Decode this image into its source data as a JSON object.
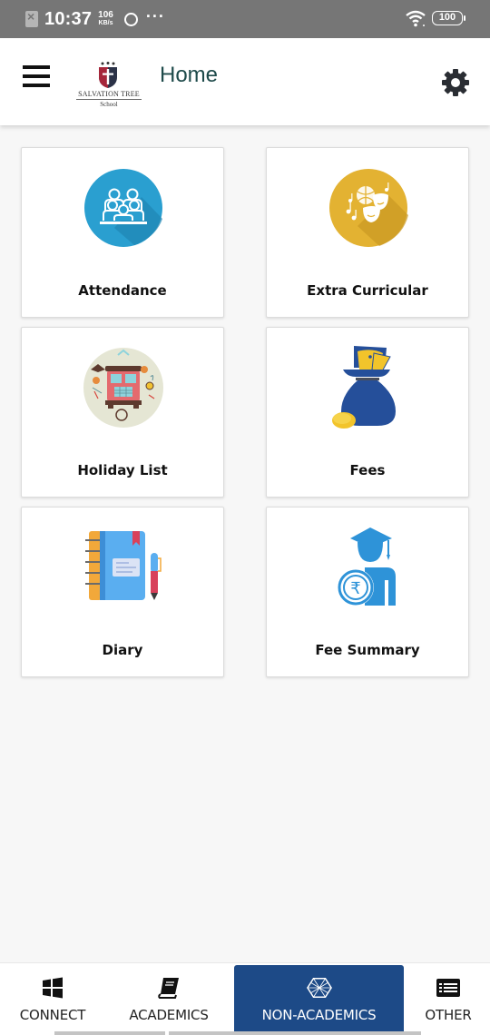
{
  "status_bar": {
    "time": "10:37",
    "net_speed_value": "106",
    "net_speed_unit": "KB/s",
    "more": "···",
    "battery": "100"
  },
  "app_bar": {
    "school_name_line1": "SALVATION TREE",
    "school_name_line2": "School",
    "title": "Home"
  },
  "tiles": [
    {
      "label": "Attendance",
      "icon": "attendance-icon",
      "color": "#2a9fd0"
    },
    {
      "label": "Extra Curricular",
      "icon": "extra-curricular-icon",
      "color": "#e3b232"
    },
    {
      "label": "Holiday List",
      "icon": "holiday-bus-icon",
      "color": "#e5e6d4"
    },
    {
      "label": "Fees",
      "icon": "money-bag-icon",
      "color": "#254f9a"
    },
    {
      "label": "Diary",
      "icon": "diary-icon",
      "color": "#5aaef0"
    },
    {
      "label": "Fee Summary",
      "icon": "fee-summary-icon",
      "color": "#2e93d8"
    }
  ],
  "bottom_nav": {
    "items": [
      {
        "label": "CONNECT",
        "icon": "windows-grid-icon",
        "active": false
      },
      {
        "label": "ACADEMICS",
        "icon": "book-icon",
        "active": false
      },
      {
        "label": "NON-ACADEMICS",
        "icon": "hexagon-network-icon",
        "active": true
      },
      {
        "label": "OTHER",
        "icon": "list-icon",
        "active": false
      }
    ],
    "active_color": "#1d4a87"
  }
}
